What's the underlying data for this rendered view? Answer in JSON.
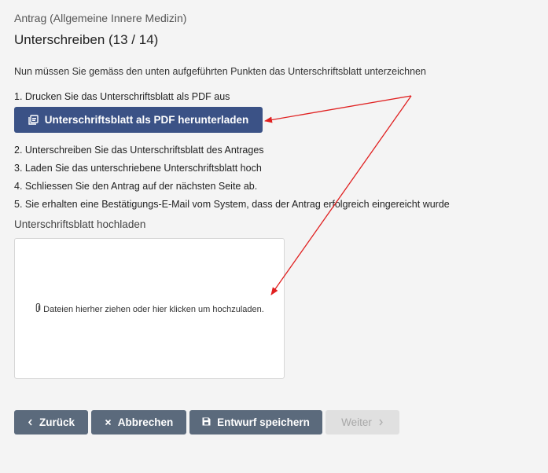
{
  "header": {
    "subtitle": "Antrag (Allgemeine Innere Medizin)",
    "title": "Unterschreiben (13 / 14)"
  },
  "intro": "Nun müssen Sie gemäss den unten aufgeführten Punkten das Unterschriftsblatt unterzeichnen",
  "steps": {
    "step1": "1. Drucken Sie das Unterschriftsblatt als PDF aus",
    "step2": "2. Unterschreiben Sie das Unterschriftsblatt des Antrages",
    "step3": "3. Laden Sie das unterschriebene Unterschriftsblatt hoch",
    "step4": "4. Schliessen Sie den Antrag auf der nächsten Seite ab.",
    "step5": "5. Sie erhalten eine Bestätigungs-E-Mail vom System, dass der Antrag erfolgreich eingereicht wurde"
  },
  "download_button": {
    "label": "Unterschriftsblatt als PDF herunterladen",
    "icon": "pdf-file-icon"
  },
  "upload": {
    "label": "Unterschriftsblatt hochladen",
    "dropzone_text": "Dateien hierher ziehen oder hier klicken um hochzuladen.",
    "icon": "paperclip-icon"
  },
  "footer_buttons": {
    "back": "Zurück",
    "cancel": "Abbrechen",
    "save_draft": "Entwurf speichern",
    "next": "Weiter"
  },
  "colors": {
    "primary": "#3b5286",
    "secondary": "#5b6a7c",
    "disabled": "#e0e0e0",
    "annotation_arrow": "#e02020",
    "background": "#f4f4f4"
  }
}
